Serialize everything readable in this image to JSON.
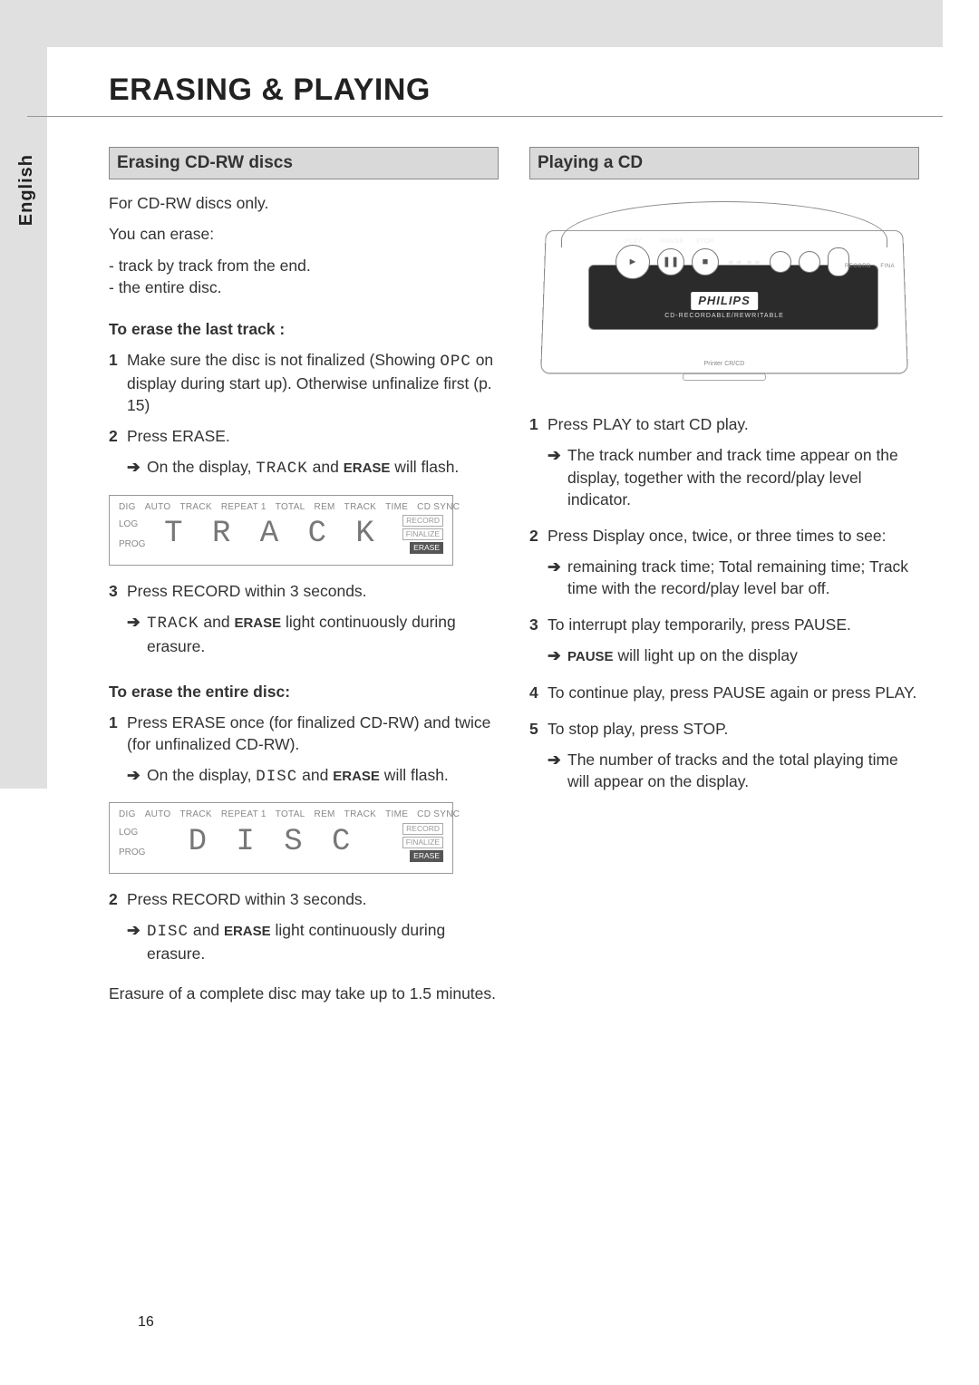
{
  "page": {
    "title": "ERASING & PLAYING",
    "language_tab": "English",
    "page_number": "16"
  },
  "left": {
    "section_title": "Erasing CD-RW discs",
    "intro": "For CD-RW discs only.",
    "you_can_erase": "You can erase:",
    "bullet1": "- track by track from the end.",
    "bullet2": "- the entire disc.",
    "h_last_track": "To erase the last track :",
    "step1a": "Make sure the disc is not finalized (Showing ",
    "step1_mono": "OPC",
    "step1b": " on display during start up). Otherwise unfinalize first (p. 15)",
    "step2": "Press ERASE.",
    "step2_arrow_a": "On the display, ",
    "step2_mono": "TRACK",
    "step2_arrow_b": "  and ",
    "step2_bold": "ERASE",
    "step2_arrow_c": " will flash.",
    "step3": "Press RECORD within 3 seconds.",
    "step3_arrow_mono": "TRACK",
    "step3_arrow_b": " and ",
    "step3_bold": "ERASE",
    "step3_arrow_c": " light continuously during erasure.",
    "h_entire_disc": "To erase the entire disc:",
    "d_step1": "Press ERASE once (for finalized CD-RW) and twice (for unfinalized CD-RW).",
    "d_step1_arrow_a": "On the display, ",
    "d_step1_mono": "DISC",
    "d_step1_arrow_b": " and ",
    "d_step1_bold": "ERASE",
    "d_step1_arrow_c": " will flash.",
    "d_step2": "Press RECORD within 3 seconds.",
    "d_step2_arrow_mono": "DISC",
    "d_step2_arrow_b": " and ",
    "d_step2_bold": "ERASE",
    "d_step2_arrow_c": " light continuously during erasure.",
    "footer": "Erasure of a complete disc may take up to 1.5 minutes."
  },
  "right": {
    "section_title": "Playing a CD",
    "device": {
      "labels": {
        "play": "PLAY",
        "pause": "PAUSE",
        "stop": "STOP",
        "prev": "◄◄",
        "next": "►►",
        "record": "RECORD",
        "finalize": "FINA"
      },
      "logo": "PHILIPS",
      "subtext": "CD-RECORDABLE/REWRITABLE",
      "baselabel": "Printer CR/CD"
    },
    "step1": "Press PLAY to start CD play.",
    "step1_arrow": "The track number and track time appear on the display, together with the record/play level indicator.",
    "step2": "Press Display once, twice, or three times to see:",
    "step2_arrow": "remaining track time; Total remaining time; Track time with the record/play level bar off.",
    "step3": "To interrupt play temporarily, press PAUSE.",
    "step3_arrow_bold": "PAUSE",
    "step3_arrow_b": " will light up on the display",
    "step4": "To continue play, press PAUSE again or press PLAY.",
    "step5": "To stop play, press STOP.",
    "step5_arrow": "The number of tracks and the total playing time will appear on the display."
  },
  "lcd": {
    "top": [
      "DIG",
      "AUTO",
      "TRACK",
      "REPEAT 1",
      "TOTAL",
      "REM",
      "TRACK",
      "TIME",
      "CD SYNC"
    ],
    "left": [
      "LOG",
      "PROG"
    ],
    "right": [
      "RECORD",
      "FINALIZE",
      "ERASE"
    ],
    "text1": "T R A C K",
    "text2": "D I S C"
  }
}
